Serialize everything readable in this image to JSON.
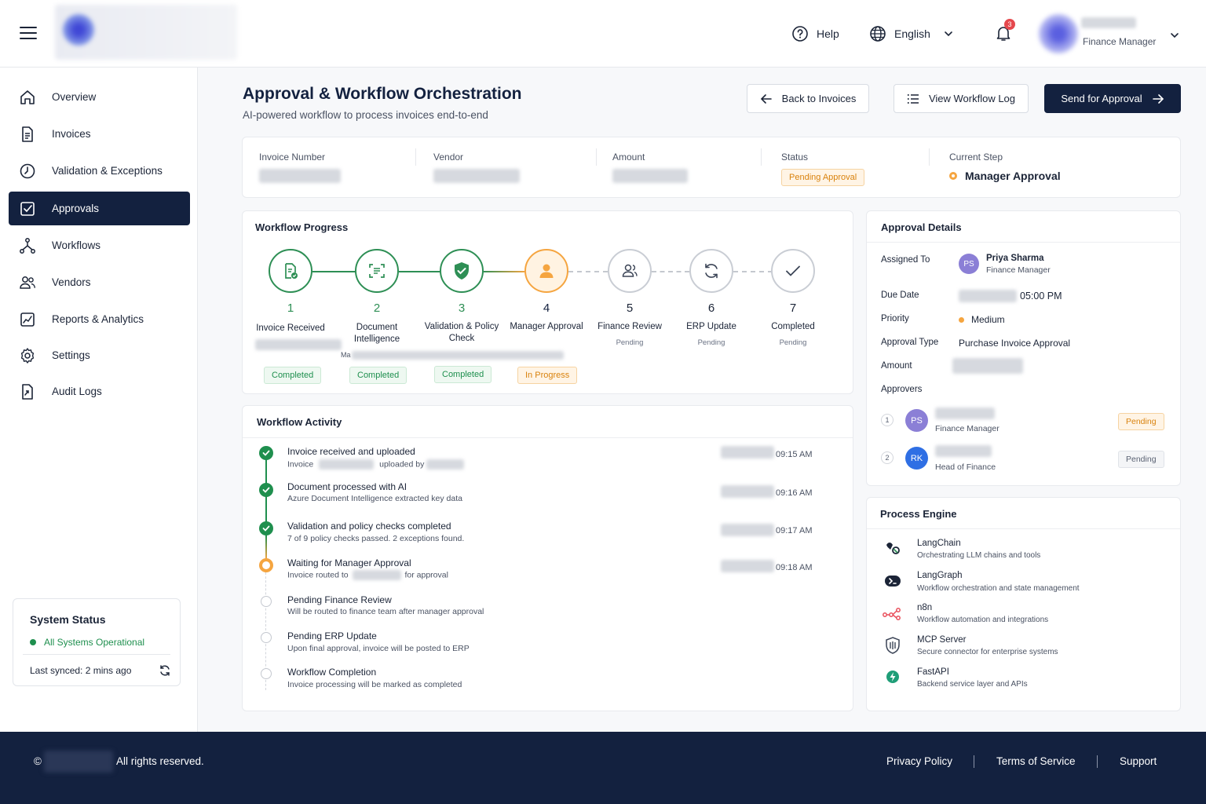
{
  "header": {
    "help_label": "Help",
    "language": "English",
    "notification_count": "3",
    "user_role": "Finance Manager"
  },
  "sidebar": {
    "items": [
      {
        "label": "Overview",
        "icon": "home-icon"
      },
      {
        "label": "Invoices",
        "icon": "document-icon"
      },
      {
        "label": "Validation & Exceptions",
        "icon": "clock-alert-icon"
      },
      {
        "label": "Approvals",
        "icon": "check-square-icon",
        "active": true
      },
      {
        "label": "Workflows",
        "icon": "workflow-icon"
      },
      {
        "label": "Vendors",
        "icon": "users-icon"
      },
      {
        "label": "Reports & Analytics",
        "icon": "chart-icon"
      },
      {
        "label": "Settings",
        "icon": "gear-icon"
      },
      {
        "label": "Audit Logs",
        "icon": "audit-icon"
      }
    ],
    "system_status": {
      "title": "System Status",
      "status": "All Systems Operational",
      "synced": "Last synced: 2 mins ago"
    }
  },
  "page": {
    "title": "Approval & Workflow Orchestration",
    "subtitle": "AI-powered workflow to process invoices end-to-end",
    "buttons": {
      "back": "Back to Invoices",
      "log": "View Workflow Log",
      "send": "Send for Approval"
    }
  },
  "invoice_info": {
    "invoice_number_label": "Invoice Number",
    "vendor_label": "Vendor",
    "amount_label": "Amount",
    "status_label": "Status",
    "status_value": "Pending Approval",
    "current_step_label": "Current Step",
    "current_step_value": "Manager Approval"
  },
  "workflow_progress": {
    "title": "Workflow Progress",
    "steps": [
      {
        "num": "1",
        "label": "Invoice Received",
        "status": "Completed",
        "state": "done",
        "icon": "document-check-icon"
      },
      {
        "num": "2",
        "label": "Document Intelligence",
        "status": "Completed",
        "state": "done",
        "icon": "scan-icon",
        "note": "Ma"
      },
      {
        "num": "3",
        "label": "Validation & Policy Check",
        "status": "Completed",
        "state": "done",
        "icon": "shield-check-icon"
      },
      {
        "num": "4",
        "label": "Manager Approval",
        "status": "In Progress",
        "state": "active",
        "icon": "user-icon"
      },
      {
        "num": "5",
        "label": "Finance Review",
        "status": "Pending",
        "state": "pending",
        "icon": "users-icon"
      },
      {
        "num": "6",
        "label": "ERP Update",
        "status": "Pending",
        "state": "pending",
        "icon": "refresh-icon"
      },
      {
        "num": "7",
        "label": "Completed",
        "status": "Pending",
        "state": "pending",
        "icon": "check-icon"
      }
    ]
  },
  "workflow_activity": {
    "title": "Workflow Activity",
    "items": [
      {
        "title": "Invoice received and uploaded",
        "desc_a": "Invoice",
        "desc_b": "uploaded by",
        "time": "09:15 AM",
        "state": "done"
      },
      {
        "title": "Document processed with AI",
        "desc": "Azure Document Intelligence extracted key data",
        "time": "09:16 AM",
        "state": "done"
      },
      {
        "title": "Validation and policy checks completed",
        "desc": "7 of 9 policy checks passed. 2 exceptions found.",
        "time": "09:17 AM",
        "state": "done"
      },
      {
        "title": "Waiting for Manager Approval",
        "desc_a": "Invoice routed to",
        "desc_b": "for approval",
        "time": "09:18 AM",
        "state": "active"
      },
      {
        "title": "Pending Finance Review",
        "desc": "Will be routed to finance team after manager approval",
        "state": "pending"
      },
      {
        "title": "Pending ERP Update",
        "desc": "Upon final approval, invoice will be posted to ERP",
        "state": "pending"
      },
      {
        "title": "Workflow Completion",
        "desc": "Invoice processing will be marked as completed",
        "state": "pending"
      }
    ]
  },
  "approval_details": {
    "title": "Approval Details",
    "assigned_to_label": "Assigned To",
    "assignee_initials": "PS",
    "assignee_name": "Priya Sharma",
    "assignee_role": "Finance Manager",
    "due_date_label": "Due Date",
    "due_time": "05:00 PM",
    "priority_label": "Priority",
    "priority_value": "Medium",
    "approval_type_label": "Approval Type",
    "approval_type_value": "Purchase Invoice Approval",
    "amount_label": "Amount",
    "approvers_label": "Approvers",
    "approvers": [
      {
        "num": "1",
        "initials": "PS",
        "role": "Finance Manager",
        "status": "Pending",
        "color": "#8b7fd6"
      },
      {
        "num": "2",
        "initials": "RK",
        "role": "Head of Finance",
        "status": "Pending",
        "color": "#2f6fe4"
      }
    ]
  },
  "process_engine": {
    "title": "Process Engine",
    "items": [
      {
        "name": "LangChain",
        "desc": "Orchestrating LLM chains and tools",
        "icon": "langchain-icon"
      },
      {
        "name": "LangGraph",
        "desc": "Workflow orchestration and state management",
        "icon": "langgraph-icon"
      },
      {
        "name": "n8n",
        "desc": "Workflow automation and integrations",
        "icon": "n8n-icon"
      },
      {
        "name": "MCP Server",
        "desc": "Secure connector for enterprise systems",
        "icon": "mcp-server-icon"
      },
      {
        "name": "FastAPI",
        "desc": "Backend service layer and APIs",
        "icon": "fastapi-icon"
      }
    ]
  },
  "footer": {
    "copyright_symbol": "©",
    "rights": "All rights reserved.",
    "privacy": "Privacy Policy",
    "terms": "Terms of Service",
    "support": "Support"
  },
  "colors": {
    "navy": "#13213f",
    "green": "#1f8f4e",
    "orange": "#f5a540",
    "danger": "#e5484d"
  }
}
